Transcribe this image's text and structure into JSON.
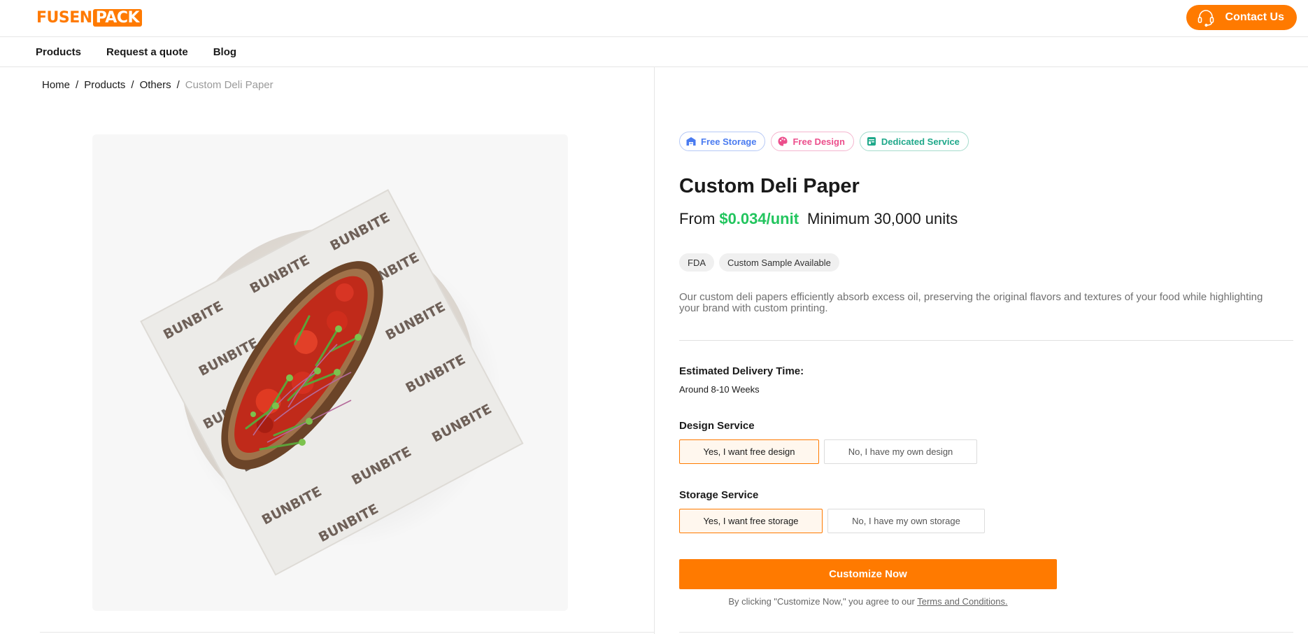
{
  "header": {
    "logo_part1": "FUSEN",
    "logo_part2": "PACK",
    "contact_label": "Contact Us",
    "contact_icon": "headset-icon"
  },
  "nav": {
    "items": [
      {
        "label": "Products"
      },
      {
        "label": "Request a quote"
      },
      {
        "label": "Blog"
      }
    ]
  },
  "breadcrumb": {
    "items": [
      "Home",
      "Products",
      "Others"
    ],
    "separator": "/",
    "current": "Custom Deli Paper"
  },
  "product_image": {
    "wrapper_text": "BUNBITE"
  },
  "badges": [
    {
      "label": "Free Storage",
      "icon": "warehouse-icon",
      "color": "#4a7bf0"
    },
    {
      "label": "Free Design",
      "icon": "palette-icon",
      "color": "#ec4f8c"
    },
    {
      "label": "Dedicated Service",
      "icon": "service-card-icon",
      "color": "#1fa88a"
    }
  ],
  "product": {
    "title": "Custom Deli Paper",
    "price_prefix": "From",
    "price": "$0.034/unit",
    "minimum": "Minimum 30,000 units",
    "tags": [
      "FDA",
      "Custom Sample Available"
    ],
    "description": "Our custom deli papers efficiently absorb excess oil, preserving the original flavors and textures of your food while highlighting your brand with custom printing."
  },
  "delivery": {
    "label": "Estimated Delivery Time:",
    "value": "Around 8-10 Weeks"
  },
  "design_service": {
    "label": "Design Service",
    "options": [
      "Yes, I want free design",
      "No, I have my own design"
    ],
    "selected": 0
  },
  "storage_service": {
    "label": "Storage Service",
    "options": [
      "Yes, I want free storage",
      "No, I have my own storage"
    ],
    "selected": 0
  },
  "cta": {
    "label": "Customize Now",
    "terms_prefix": "By clicking \"Customize Now,\" you agree to our",
    "terms_link": "Terms and Conditions."
  },
  "colors": {
    "brand": "#ff7a00",
    "price": "#22c55e"
  }
}
